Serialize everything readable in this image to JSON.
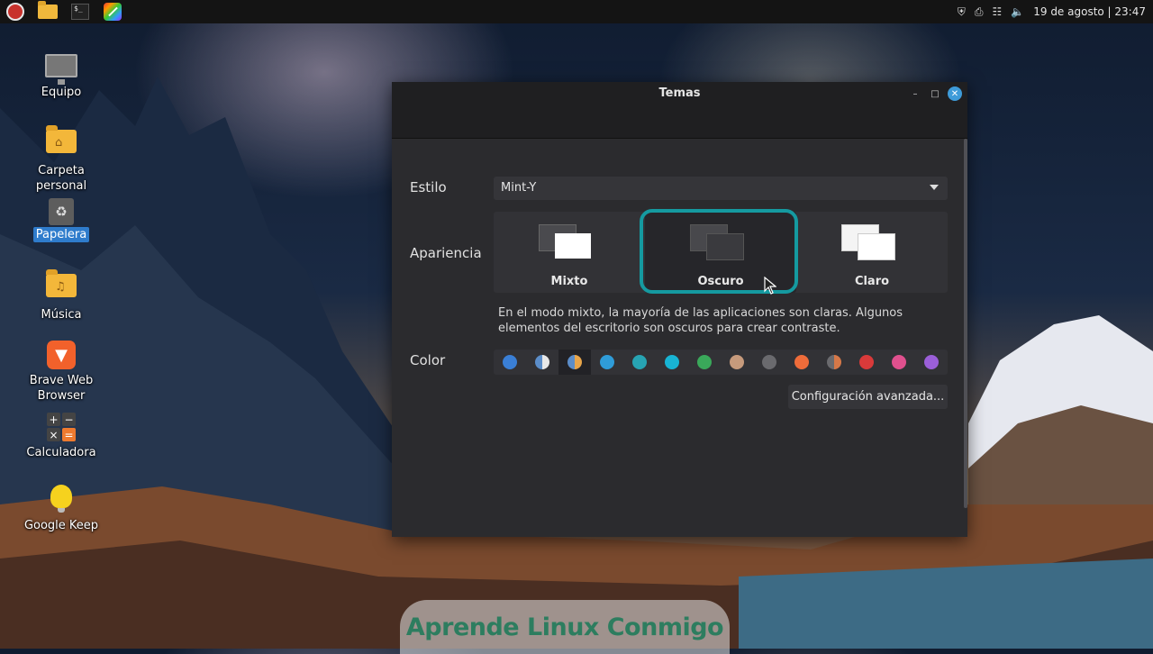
{
  "panel": {
    "clock": "19 de agosto | 23:47",
    "tray_icons": [
      "shield-icon",
      "printer-icon",
      "network-icon",
      "volume-icon"
    ]
  },
  "desktop": {
    "icons": [
      {
        "label": "Equipo",
        "icon": "computer-icon"
      },
      {
        "label": "Carpeta\npersonal",
        "icon": "home-folder-icon"
      },
      {
        "label": "Papelera",
        "icon": "trash-icon"
      },
      {
        "label": "Música",
        "icon": "music-folder-icon"
      },
      {
        "label": "Brave Web\nBrowser",
        "icon": "brave-icon"
      },
      {
        "label": "Calculadora",
        "icon": "calculator-icon"
      },
      {
        "label": "Google Keep",
        "icon": "lightbulb-icon"
      }
    ]
  },
  "window": {
    "title": "Temas",
    "style_label": "Estilo",
    "style_value": "Mint-Y",
    "appearance_label": "Apariencia",
    "appearance_options": [
      "Mixto",
      "Oscuro",
      "Claro"
    ],
    "selected_appearance": "Oscuro",
    "description": "En el modo mixto, la mayoría de las aplicaciones son claras. Algunos elementos del escritorio son oscuros para crear contraste.",
    "color_label": "Color",
    "colors": [
      "#3a7fd6",
      "#5b8dc9",
      "#e8a54a",
      "#2f9cd8",
      "#27a4b3",
      "#18b4d4",
      "#3aa85a",
      "#c69a7c",
      "#6a6a6e",
      "#ef6c3a",
      "#d67848",
      "#d93a3a",
      "#e0508e",
      "#9b5fd9"
    ],
    "selected_color_index": 2,
    "advanced_button": "Configuración avanzada..."
  },
  "watermark": "Aprende Linux Conmigo"
}
